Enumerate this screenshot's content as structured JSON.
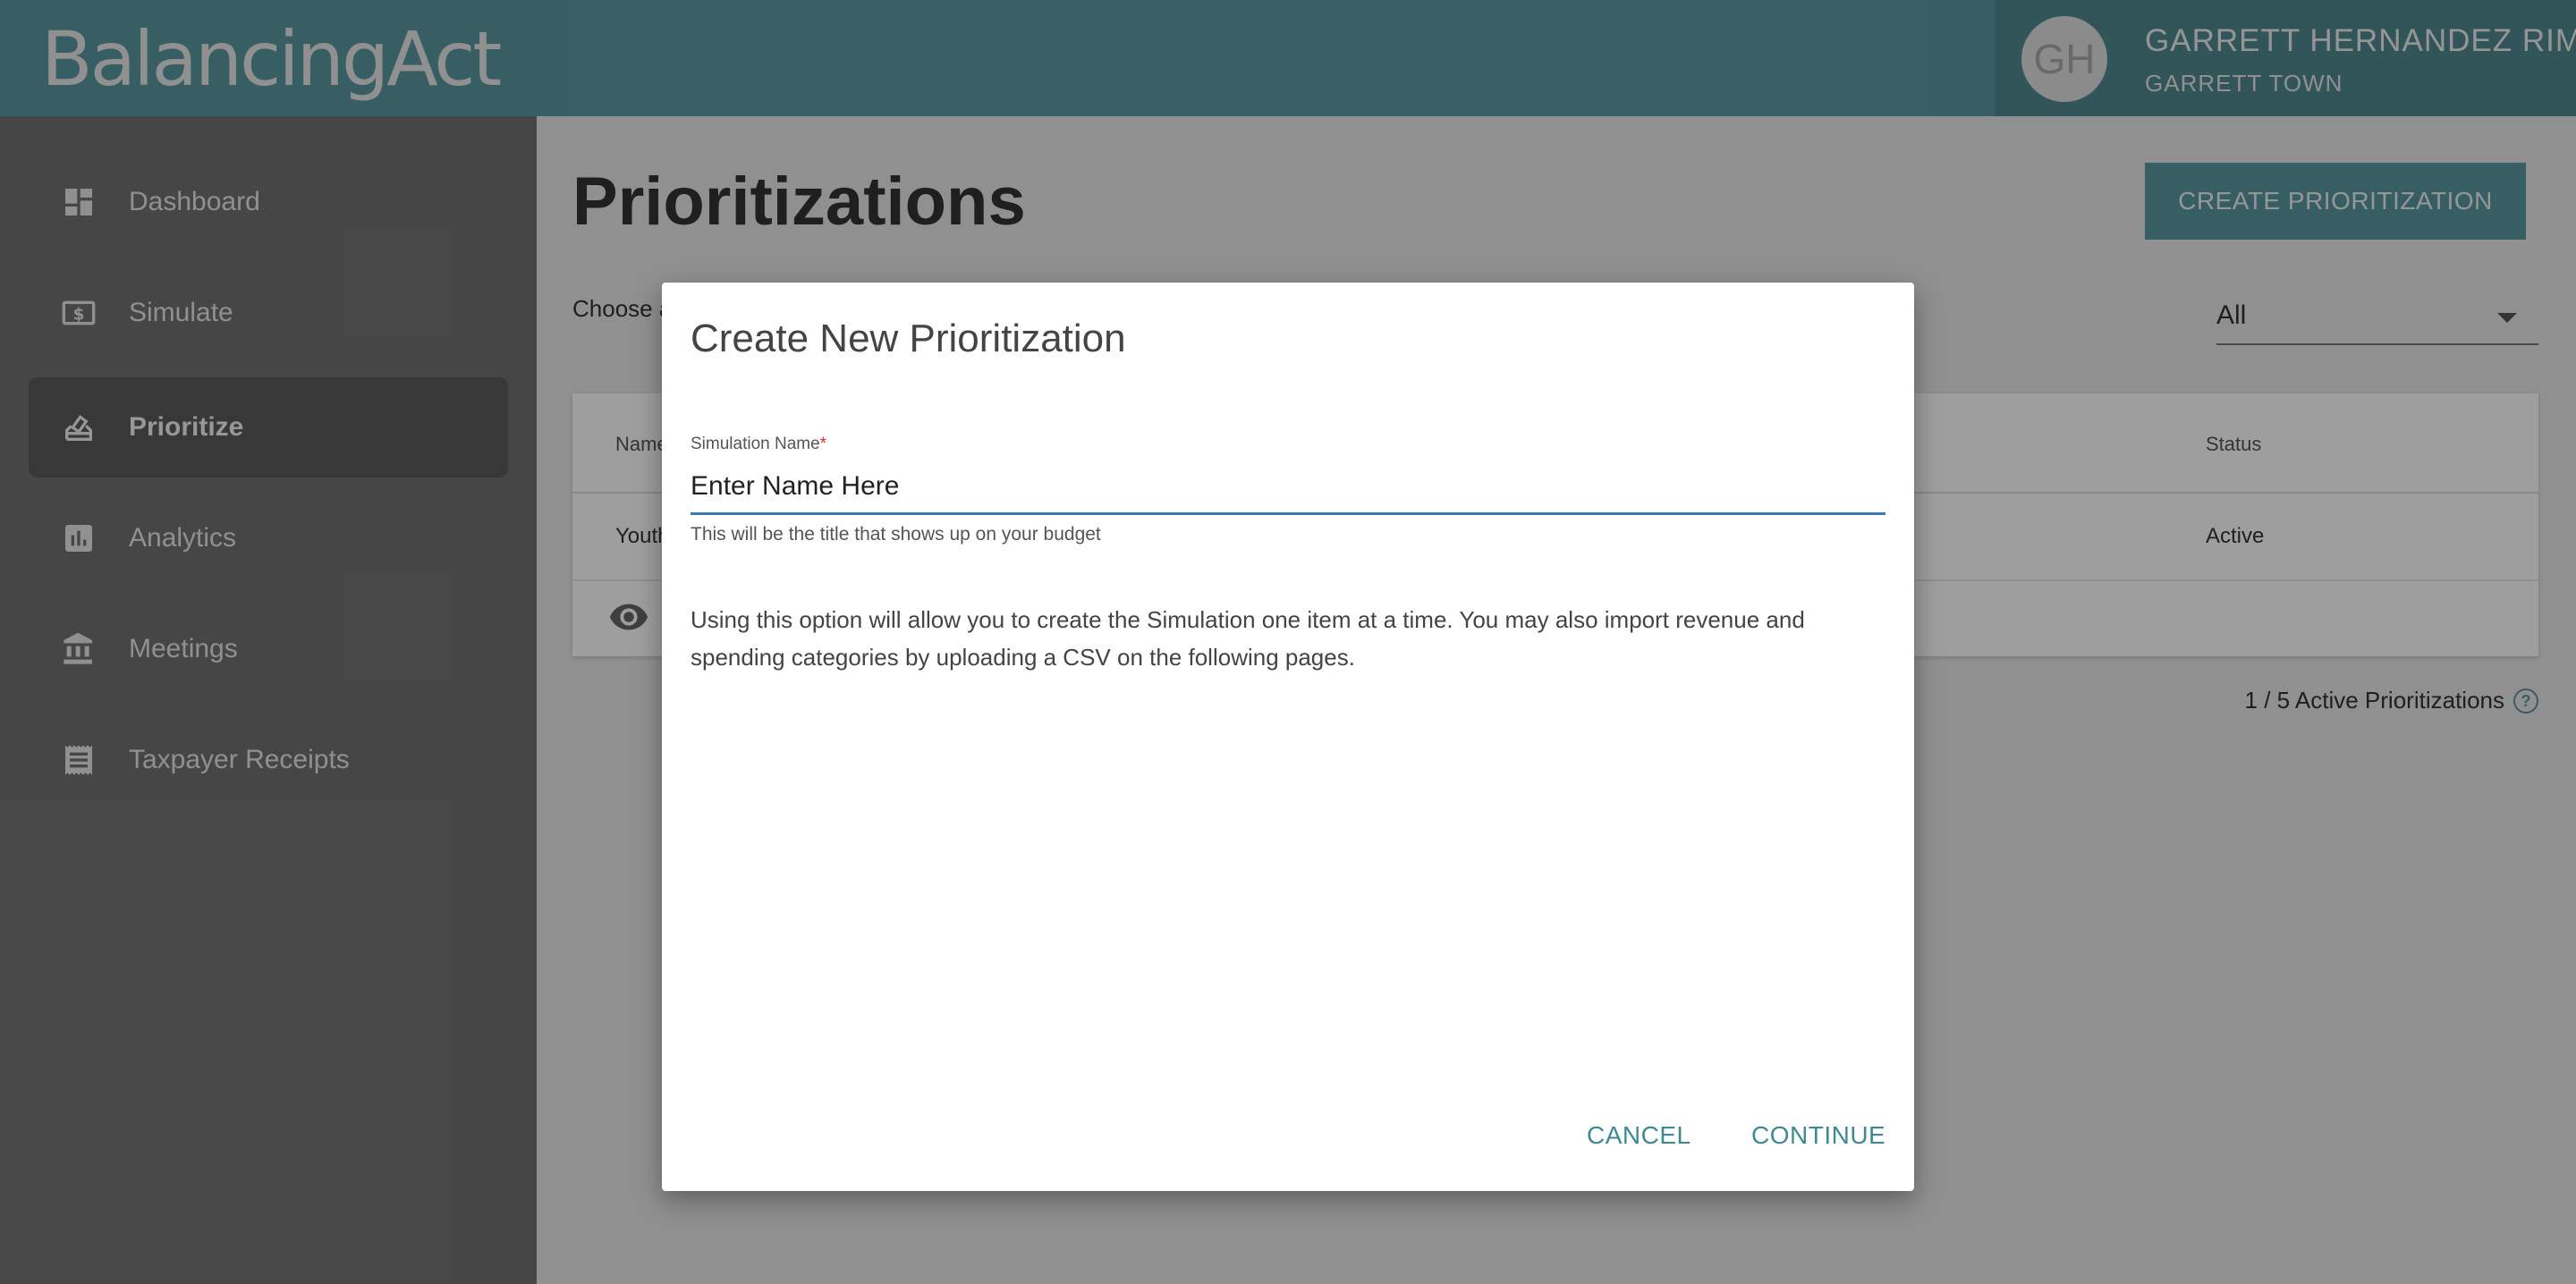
{
  "app": {
    "logo_text": "BalancingAct"
  },
  "user": {
    "initials": "GH",
    "name": "GARRETT HERNANDEZ RIMER",
    "town": "GARRETT TOWN"
  },
  "sidebar": {
    "items": [
      {
        "label": "Dashboard",
        "icon": "dashboard-icon",
        "active": false
      },
      {
        "label": "Simulate",
        "icon": "dollar-icon",
        "active": false
      },
      {
        "label": "Prioritize",
        "icon": "ballot-icon",
        "active": true
      },
      {
        "label": "Analytics",
        "icon": "bar-chart-icon",
        "active": false
      },
      {
        "label": "Meetings",
        "icon": "bank-icon",
        "active": false
      },
      {
        "label": "Taxpayer Receipts",
        "icon": "receipt-icon",
        "active": false
      }
    ]
  },
  "main": {
    "title": "Prioritizations",
    "create_button": "CREATE PRIORITIZATION",
    "choose_text": "Choose a",
    "filter_value": "All",
    "table": {
      "headers": {
        "name": "Name",
        "status": "Status"
      },
      "rows": [
        {
          "name": "Youth",
          "status": "Active"
        }
      ]
    },
    "active_count": "1 / 5 Active Prioritizations"
  },
  "modal": {
    "title": "Create New Prioritization",
    "field_label": "Simulation Name",
    "required_mark": "*",
    "field_placeholder": "Enter Name Here",
    "helper_text": "This will be the title that shows up on your budget",
    "description": "Using this option will allow you to create the Simulation one item at a time. You may also import revenue and spending categories by uploading a CSV on the following pages.",
    "cancel_label": "CANCEL",
    "continue_label": "CONTINUE"
  },
  "colors": {
    "brand": "#5a9aa1",
    "input_focus": "#3a78b8",
    "sidebar": "#727272",
    "required": "#d03030"
  }
}
